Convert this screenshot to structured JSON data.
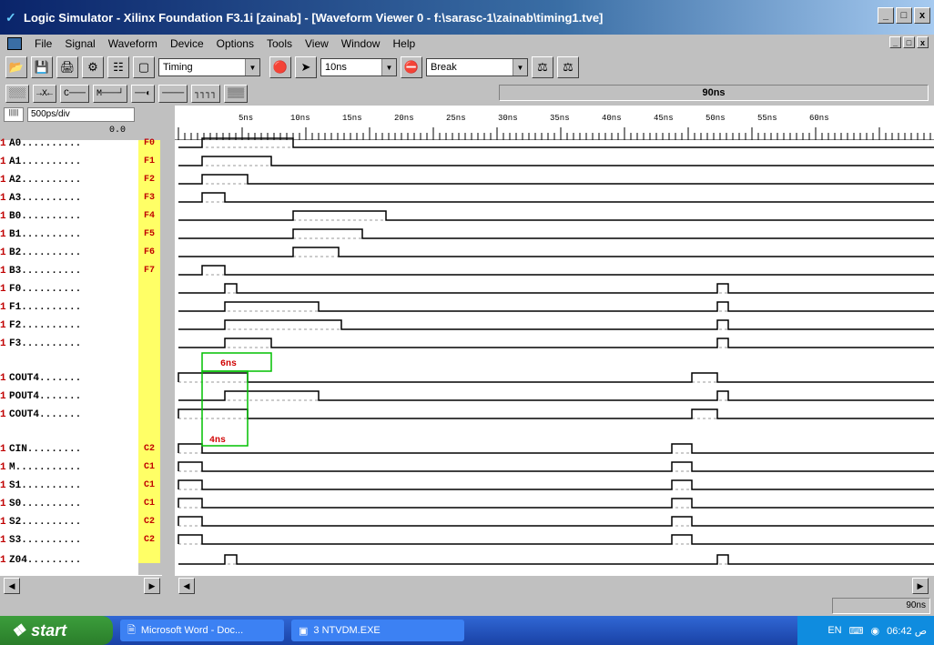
{
  "window": {
    "title": "Logic Simulator - Xilinx Foundation F3.1i [zainab] - [Waveform Viewer 0  -  f:\\sarasc-1\\zainab\\timing1.tve]",
    "buttons": [
      "_",
      "□",
      "x"
    ]
  },
  "menu": [
    "File",
    "Signal",
    "Waveform",
    "Device",
    "Options",
    "Tools",
    "View",
    "Window",
    "Help"
  ],
  "toolbar": {
    "mode_value": "Timing",
    "step_value": "10ns",
    "break_value": "Break"
  },
  "toolbar2": {
    "buttons": [
      "░░░",
      "→X←",
      "C───",
      "M───┘",
      "──◐",
      "────",
      "┐┐┐┐",
      "▒▒▒"
    ],
    "status_time": "90ns"
  },
  "viewer": {
    "scale_label": "500ps/div",
    "zero_label": "0.0",
    "ruler_labels": [
      "5ns",
      "10ns",
      "15ns",
      "20ns",
      "25ns",
      "30ns",
      "35ns",
      "40ns",
      "45ns",
      "50ns",
      "55ns",
      "60ns"
    ],
    "signals": [
      {
        "level": "1",
        "name": "A0..........",
        "pin": "F0"
      },
      {
        "level": "1",
        "name": "A1..........",
        "pin": "F1"
      },
      {
        "level": "1",
        "name": "A2..........",
        "pin": "F2"
      },
      {
        "level": "1",
        "name": "A3..........",
        "pin": "F3"
      },
      {
        "level": "1",
        "name": "B0..........",
        "pin": "F4"
      },
      {
        "level": "1",
        "name": "B1..........",
        "pin": "F5"
      },
      {
        "level": "1",
        "name": "B2..........",
        "pin": "F6"
      },
      {
        "level": "1",
        "name": "B3..........",
        "pin": "F7"
      },
      {
        "level": "1",
        "name": "F0..........",
        "pin": ""
      },
      {
        "level": "1",
        "name": "F1..........",
        "pin": ""
      },
      {
        "level": "1",
        "name": "F2..........",
        "pin": ""
      },
      {
        "level": "1",
        "name": "F3..........",
        "pin": ""
      },
      {
        "level": "1",
        "name": "COUT4.......",
        "pin": ""
      },
      {
        "level": "1",
        "name": "POUT4.......",
        "pin": ""
      },
      {
        "level": "1",
        "name": "COUT4.......",
        "pin": ""
      },
      {
        "level": "1",
        "name": "CIN.........",
        "pin": "C2"
      },
      {
        "level": "1",
        "name": "M...........",
        "pin": "C1"
      },
      {
        "level": "1",
        "name": "S1..........",
        "pin": "C1"
      },
      {
        "level": "1",
        "name": "S0..........",
        "pin": "C1"
      },
      {
        "level": "1",
        "name": "S2..........",
        "pin": "C2"
      },
      {
        "level": "1",
        "name": "S3..........",
        "pin": "C2"
      },
      {
        "level": "1",
        "name": "Z04.........",
        "pin": ""
      }
    ],
    "annotations": [
      "6ns",
      "4ns"
    ],
    "cursor_time": "90ns"
  },
  "taskbar": {
    "start": "start",
    "tasks": [
      "Microsoft Word - Doc...",
      "3 NTVDM.EXE"
    ],
    "lang": "EN",
    "clock": "06:42 ص"
  }
}
